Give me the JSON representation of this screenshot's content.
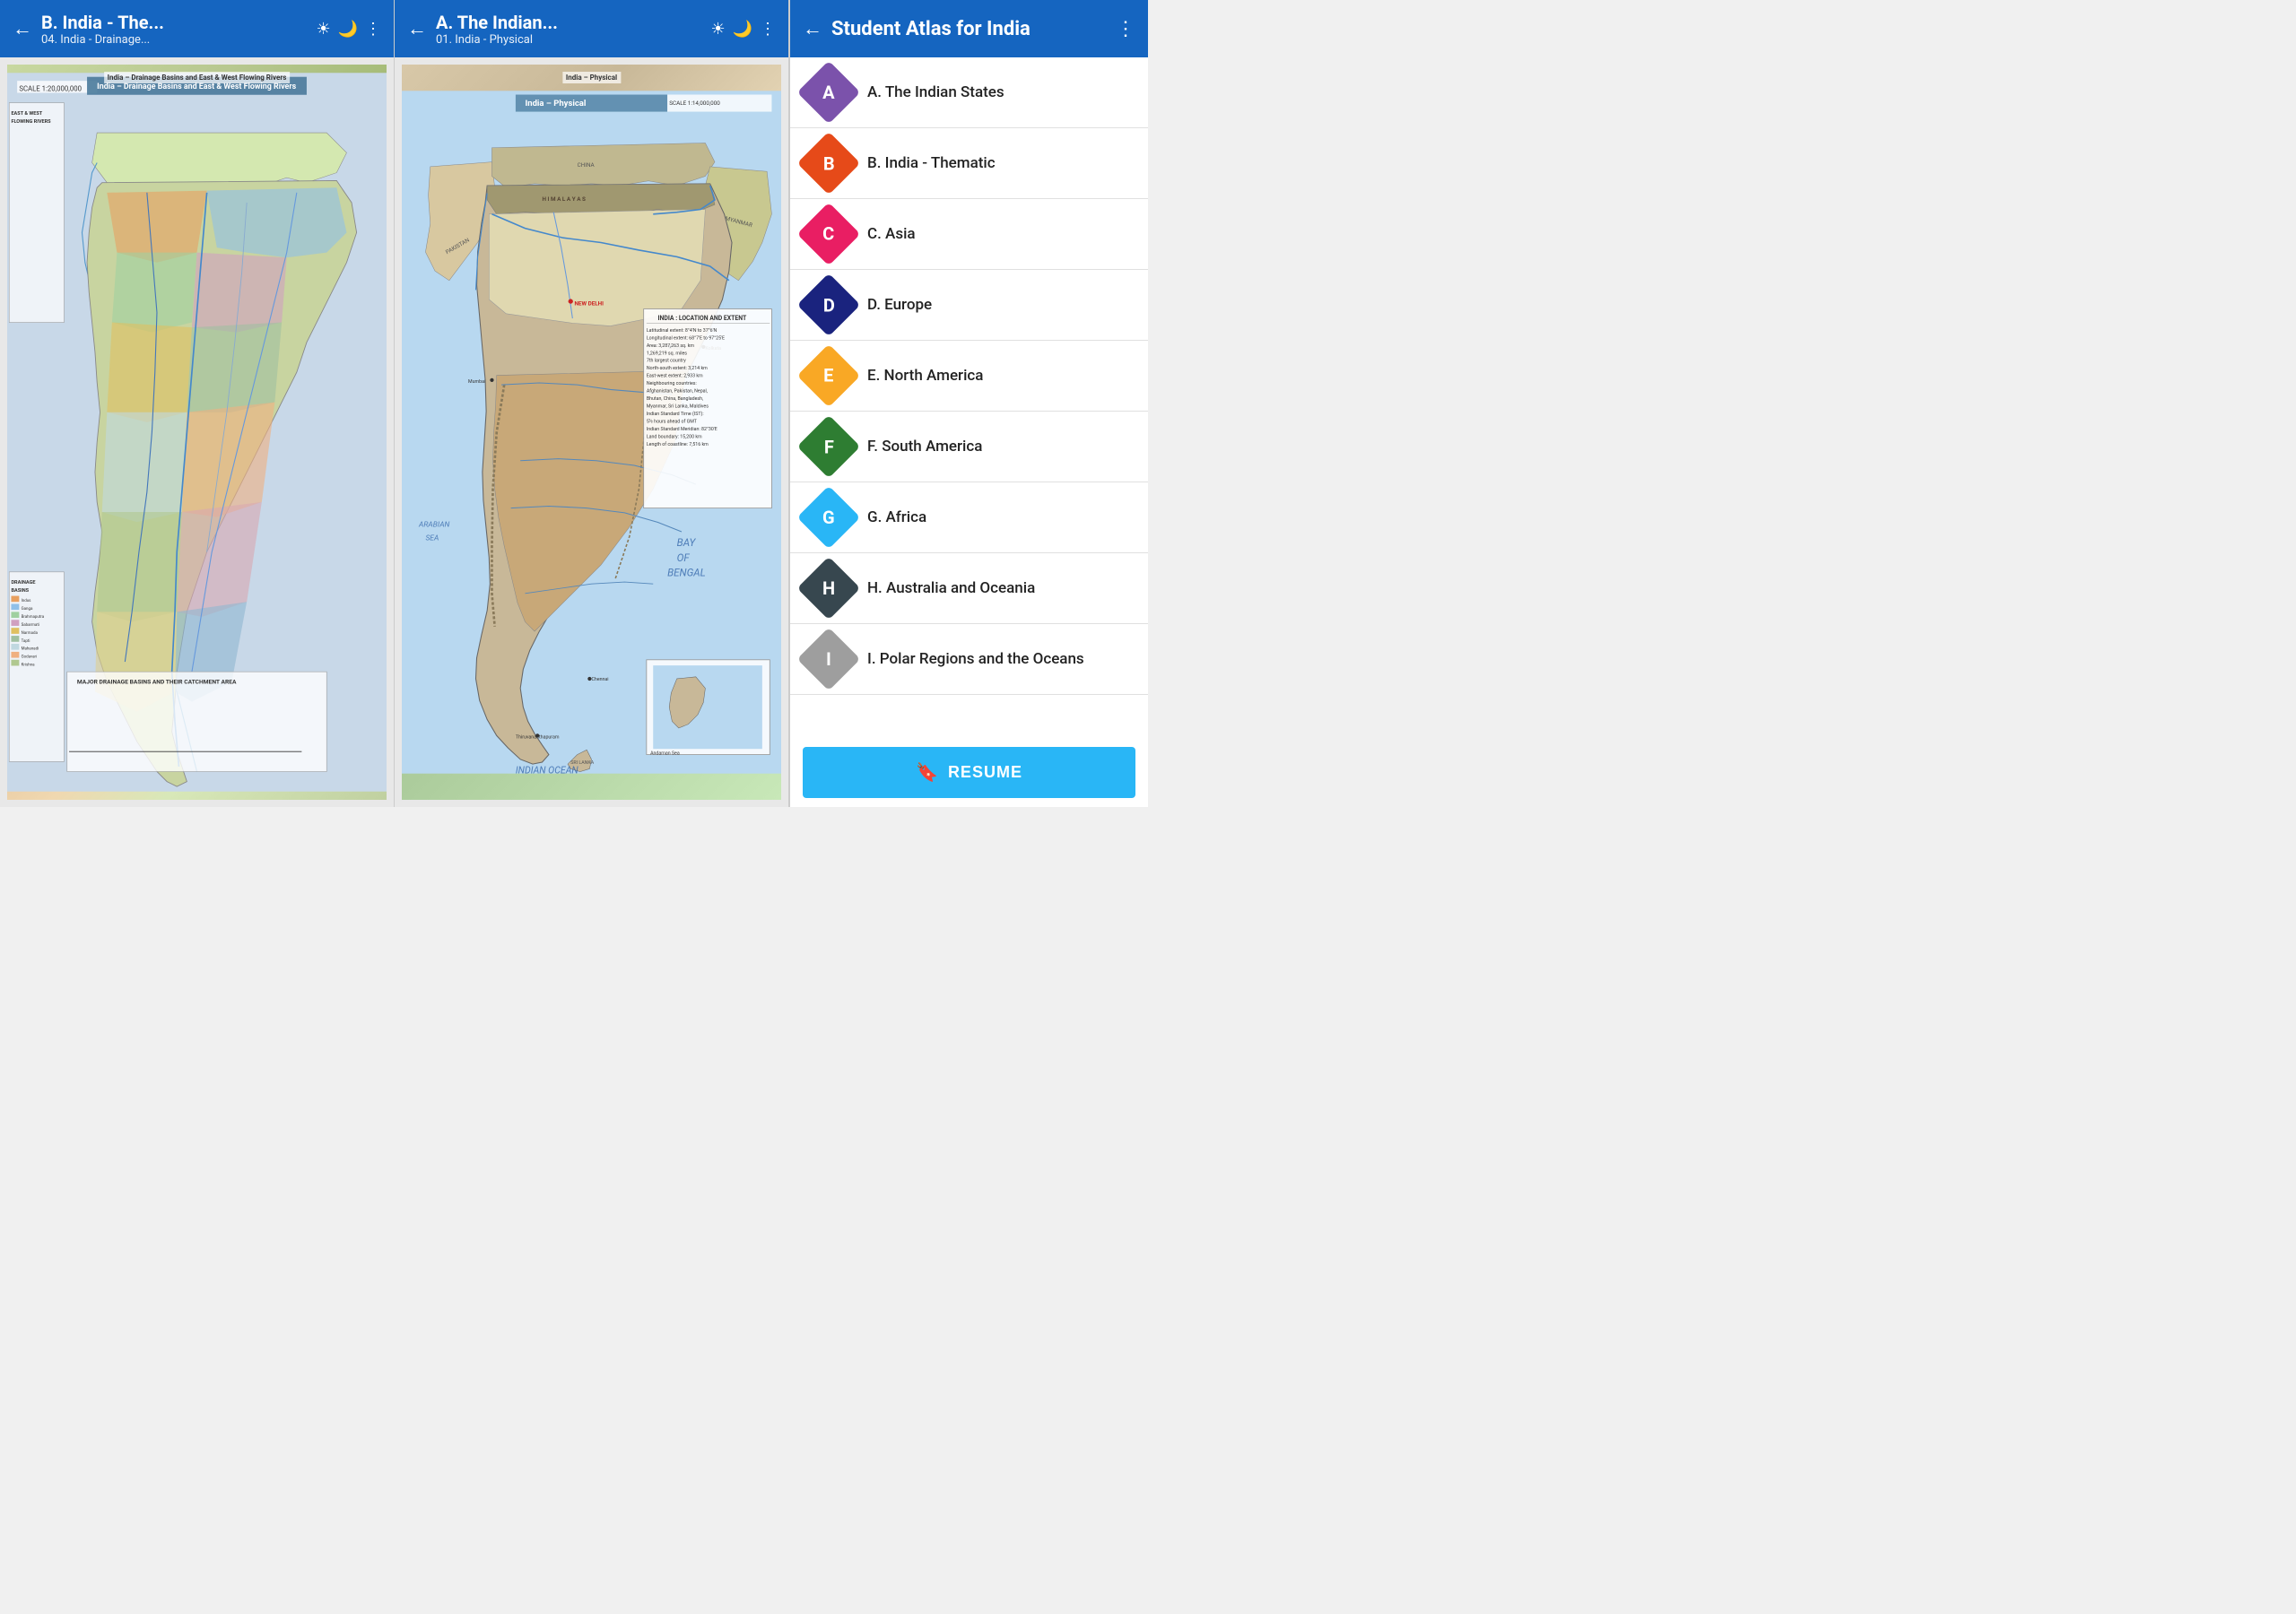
{
  "left_panel": {
    "header": {
      "title": "B. India - The...",
      "subtitle": "04. India - Drainage...",
      "back_label": "←",
      "sun_icon": "☀",
      "moon_icon": "🌙",
      "more_icon": "⋮"
    },
    "map_title": "India – Drainage Basins and East & West Flowing Rivers"
  },
  "middle_panel": {
    "header": {
      "title": "A. The Indian...",
      "subtitle": "01. India - Physical",
      "back_label": "←",
      "sun_icon": "☀",
      "moon_icon": "🌙",
      "more_icon": "⋮"
    },
    "map_title": "India – Physical",
    "info_box": {
      "title": "INDIA : LOCATION AND EXTENT",
      "lines": [
        "Latitudinal extent: 8 degree 4'N to 37 degree 6'N",
        "Longitudinal extent: 68 degree 7'E to 97 degree 25'E",
        "Area: 3,287,263 sq. km",
        "1,269,219 sq. miles",
        "7th largest country",
        "North-south extent: 3,214 km",
        "East-west extent: 2,933 km",
        "Neighbouring countries: Afghanistan, Pakistan, Nepal,",
        "Bhutan, China, Bangladesh,",
        "Myanmar, Sri Lanka, Maldives",
        "Indian Standard Time (IST): 5½ hours ahead of GMT",
        "Indian Standard Meridian: 82° 30' E",
        "Land boundary: 15,200 km",
        "Length of coastline: 7,516 km"
      ]
    }
  },
  "atlas_panel": {
    "header": {
      "title": "Student Atlas for India",
      "back_label": "←",
      "more_icon": "⋮"
    },
    "items": [
      {
        "id": "a",
        "letter": "A",
        "label": "A. The Indian States",
        "color_class": "color-a"
      },
      {
        "id": "b",
        "letter": "B",
        "label": "B. India - Thematic",
        "color_class": "color-b"
      },
      {
        "id": "c",
        "letter": "C",
        "label": "C. Asia",
        "color_class": "color-c"
      },
      {
        "id": "d",
        "letter": "D",
        "label": "D. Europe",
        "color_class": "color-d"
      },
      {
        "id": "e",
        "letter": "E",
        "label": "E. North America",
        "color_class": "color-e"
      },
      {
        "id": "f",
        "letter": "F",
        "label": "F. South America",
        "color_class": "color-f"
      },
      {
        "id": "g",
        "letter": "G",
        "label": "G. Africa",
        "color_class": "color-g"
      },
      {
        "id": "h",
        "letter": "H",
        "label": "H. Australia and Oceania",
        "color_class": "color-h"
      },
      {
        "id": "i",
        "letter": "I",
        "label": "I. Polar Regions and the Oceans",
        "color_class": "color-i"
      }
    ],
    "resume_button": {
      "label": "RESUME",
      "bookmark_icon": "🔖"
    }
  }
}
